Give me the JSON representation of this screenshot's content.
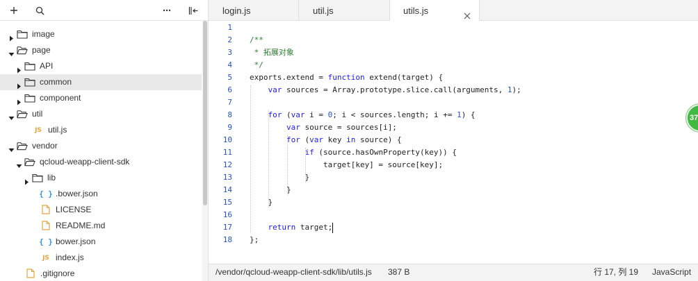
{
  "sidebar": {
    "toolbar": {
      "add": "+",
      "more": "···"
    },
    "tree": [
      {
        "label": "image",
        "type": "folder",
        "expanded": false
      },
      {
        "label": "page",
        "type": "folder",
        "expanded": true
      },
      {
        "label": "API",
        "type": "folder",
        "expanded": false
      },
      {
        "label": "common",
        "type": "folder",
        "expanded": false,
        "selected": true
      },
      {
        "label": "component",
        "type": "folder",
        "expanded": false
      },
      {
        "label": "util",
        "type": "folder",
        "expanded": true
      },
      {
        "label": "util.js",
        "type": "js",
        "icon_text": "JS"
      },
      {
        "label": "vendor",
        "type": "folder",
        "expanded": true
      },
      {
        "label": "qcloud-weapp-client-sdk",
        "type": "folder",
        "expanded": true
      },
      {
        "label": "lib",
        "type": "folder",
        "expanded": false
      },
      {
        "label": ".bower.json",
        "type": "json",
        "icon_text": "{ }"
      },
      {
        "label": "LICENSE",
        "type": "file"
      },
      {
        "label": "README.md",
        "type": "file"
      },
      {
        "label": "bower.json",
        "type": "json",
        "icon_text": "{ }"
      },
      {
        "label": "index.js",
        "type": "js",
        "icon_text": "JS"
      },
      {
        "label": ".gitignore",
        "type": "file"
      }
    ]
  },
  "tabs": [
    {
      "label": "login.js",
      "active": false
    },
    {
      "label": "util.js",
      "active": false
    },
    {
      "label": "utils.js",
      "active": true
    }
  ],
  "editor": {
    "line_numbers": [
      "1",
      "2",
      "3",
      "4",
      "5",
      "6",
      "7",
      "8",
      "9",
      "10",
      "11",
      "12",
      "13",
      "14",
      "15",
      "16",
      "17",
      "18"
    ],
    "lines": [
      [],
      [
        {
          "t": "/**",
          "c": "cm"
        }
      ],
      [
        {
          "t": " * 拓展对象",
          "c": "cm"
        }
      ],
      [
        {
          "t": " */",
          "c": "cm"
        }
      ],
      [
        {
          "t": "exports.extend = "
        },
        {
          "t": "function",
          "c": "kw"
        },
        {
          "t": " extend(target) {"
        }
      ],
      [
        {
          "t": "    "
        },
        {
          "t": "var",
          "c": "kw"
        },
        {
          "t": " sources = Array.prototype.slice.call(arguments, "
        },
        {
          "t": "1",
          "c": "num"
        },
        {
          "t": ");"
        }
      ],
      [],
      [
        {
          "t": "    "
        },
        {
          "t": "for",
          "c": "kw"
        },
        {
          "t": " ("
        },
        {
          "t": "var",
          "c": "kw"
        },
        {
          "t": " i = "
        },
        {
          "t": "0",
          "c": "num"
        },
        {
          "t": "; i < sources.length; i += "
        },
        {
          "t": "1",
          "c": "num"
        },
        {
          "t": ") {"
        }
      ],
      [
        {
          "t": "        "
        },
        {
          "t": "var",
          "c": "kw"
        },
        {
          "t": " source = sources[i];"
        }
      ],
      [
        {
          "t": "        "
        },
        {
          "t": "for",
          "c": "kw"
        },
        {
          "t": " ("
        },
        {
          "t": "var",
          "c": "kw"
        },
        {
          "t": " key "
        },
        {
          "t": "in",
          "c": "kw"
        },
        {
          "t": " source) {"
        }
      ],
      [
        {
          "t": "            "
        },
        {
          "t": "if",
          "c": "kw"
        },
        {
          "t": " (source.hasOwnProperty(key)) {"
        }
      ],
      [
        {
          "t": "                target[key] = source[key];"
        }
      ],
      [
        {
          "t": "            }"
        }
      ],
      [
        {
          "t": "        }"
        }
      ],
      [
        {
          "t": "    }"
        }
      ],
      [],
      [
        {
          "t": "    "
        },
        {
          "t": "return",
          "c": "kw"
        },
        {
          "t": " target;"
        }
      ],
      [
        {
          "t": "};"
        }
      ]
    ],
    "cursor_line": 17,
    "overlay_badge": "37"
  },
  "statusbar": {
    "path": "/vendor/qcloud-weapp-client-sdk/lib/utils.js",
    "size": "387 B",
    "position": "行 17, 列 19",
    "language": "JavaScript"
  },
  "colors": {
    "keyword": "#1a1aff",
    "number": "#2a52be",
    "comment": "#2e7d32",
    "js_icon": "#e8a33d",
    "json_icon": "#3b8fd9",
    "badge": "#3fb93f"
  }
}
